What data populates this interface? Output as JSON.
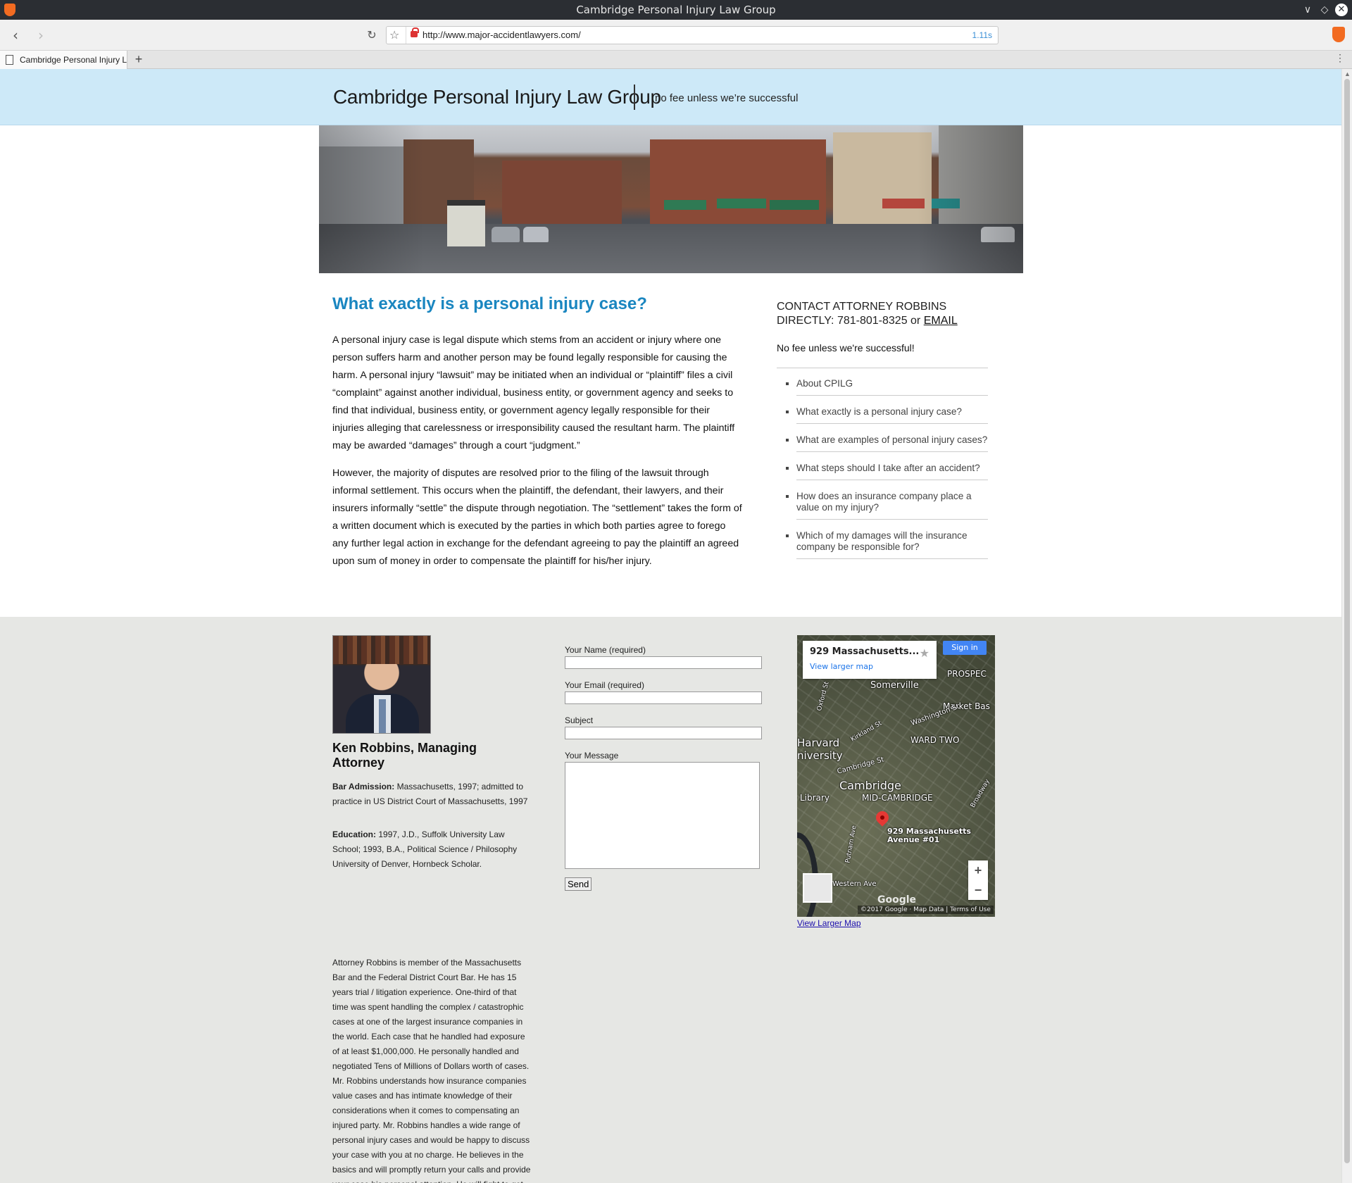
{
  "browser": {
    "window_title": "Cambridge Personal Injury Law Group",
    "url": "http://www.major-accidentlawyers.com/",
    "load_time": "1.11s",
    "tab_title": "Cambridge Personal Injury Law Group",
    "icons": {
      "back": "back-arrow-icon",
      "forward": "forward-arrow-icon",
      "reload": "reload-icon",
      "bookmark": "star-icon",
      "insecure": "insecure-lock-icon",
      "new_tab": "plus-icon"
    }
  },
  "site": {
    "title": "Cambridge Personal Injury Law Group",
    "tagline": "no fee unless we’re successful",
    "accent_color": "#1a86c0",
    "header_bg": "#cde9f8"
  },
  "article": {
    "heading": "What exactly is a personal injury case?",
    "paragraphs": [
      "A personal injury case is legal dispute which stems from an accident or injury where one person suffers harm and another person may be found legally responsible for causing the harm. A personal injury “lawsuit” may be initiated when an individual or “plaintiff” files a civil “complaint” against another individual, business entity, or government agency and seeks to find that individual, business entity, or government agency legally responsible for their injuries alleging that carelessness or irresponsibility caused the resultant harm. The plaintiff may be awarded “damages” through a court “judgment.”",
      "However, the majority of disputes are resolved prior to the filing of the lawsuit through informal settlement. This occurs when the plaintiff, the defendant, their lawyers, and their insurers informally “settle” the dispute through negotiation. The “settlement” takes the form of a written document which is executed by the parties in which both parties agree to forego any further legal action in exchange for the defendant agreeing to pay the plaintiff an agreed upon sum of money in order to compensate the plaintiff for his/her injury."
    ]
  },
  "sidebar": {
    "contact_text": "CONTACT ATTORNEY ROBBINS DIRECTLY: 781-801-8325 or",
    "email_link": "EMAIL",
    "no_fee": "No fee unless we're successful!",
    "menu": [
      "About CPILG",
      "What exactly is a personal injury case?",
      "What are examples of personal injury cases?",
      "What steps should I take after an accident?",
      "How does an insurance company place a value on my injury?",
      "Which of my damages will the insurance company be responsible for?"
    ]
  },
  "attorney": {
    "name": "Ken Robbins, Managing Attorney",
    "bar_label": "Bar Admission:",
    "bar_text": "Massachusetts, 1997; admitted to practice in US District Court of Massachusetts, 1997",
    "edu_label": "Education:",
    "edu_text": "1997, J.D., Suffolk University Law School; 1993, B.A., Political Science / Philosophy University of Denver, Hornbeck Scholar.",
    "bio": "Attorney Robbins is member of the Massachusetts Bar and the Federal District Court Bar. He has 15 years trial / litigation experience. One-third of that time was spent handling the complex / catastrophic cases at one of the largest insurance companies in the world. Each case that he handled had exposure of at least $1,000,000. He personally handled and negotiated Tens of Millions of Dollars worth of cases. Mr. Robbins understands how insurance companies value cases and has intimate knowledge of their considerations when it comes to compensating an injured party. Mr. Robbins handles a wide range of personal injury cases and would be happy to discuss your case with you at no charge. He believes in the basics and will promptly return your calls and provide your case his personal attention. He will fight to get you the proper amount of compensation every time."
  },
  "form": {
    "name_label": "Your Name (required)",
    "email_label": "Your Email (required)",
    "subject_label": "Subject",
    "message_label": "Your Message",
    "name_value": "",
    "email_value": "",
    "subject_value": "",
    "message_value": "",
    "send_label": "Send"
  },
  "map": {
    "place": "929 Massachusetts...",
    "view_larger_inline": "View larger map",
    "sign_in": "Sign in",
    "labels": [
      "Somerville",
      "PROSPEC",
      "Market Bas",
      "Harvard",
      "niversity",
      "Kirkland St",
      "WARD TWO",
      "Washington St",
      "Cambridge St",
      "Cambridge",
      "MID-CAMBRIDGE",
      "Library",
      "929 Massachusetts",
      "Avenue #01",
      "Western Ave",
      "Broadway",
      "Putnam Ave",
      "Oxford St"
    ],
    "attribution": "©2017 Google · Map Data | Terms of Use",
    "logo": "Google",
    "zoom_in": "+",
    "zoom_out": "−",
    "view_larger_below": "View Larger Map"
  }
}
